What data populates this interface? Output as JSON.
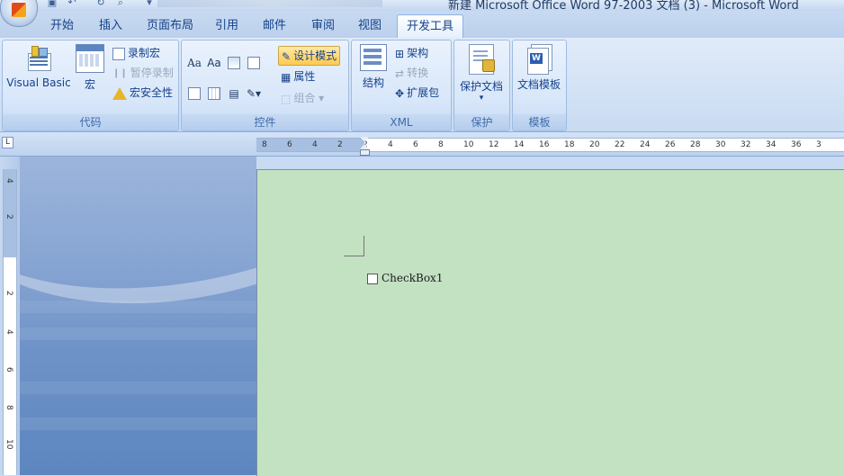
{
  "window": {
    "title": "新建 Microsoft Office Word 97-2003 文档 (3) - Microsoft Word"
  },
  "tabs": [
    {
      "label": "开始"
    },
    {
      "label": "插入"
    },
    {
      "label": "页面布局"
    },
    {
      "label": "引用"
    },
    {
      "label": "邮件"
    },
    {
      "label": "审阅"
    },
    {
      "label": "视图"
    },
    {
      "label": "开发工具",
      "active": true
    }
  ],
  "ribbon": {
    "code": {
      "label": "代码",
      "visual_basic": "Visual Basic",
      "macros": "宏",
      "record_macro": "录制宏",
      "pause_recording": "暂停录制",
      "macro_security": "宏安全性"
    },
    "controls": {
      "label": "控件",
      "rich_text": "Aa",
      "plain_text": "Aa",
      "design_mode": "设计模式",
      "properties": "属性",
      "group": "组合"
    },
    "xml": {
      "label": "XML",
      "structure": "结构",
      "schema": "架构",
      "transform": "转换",
      "expansion_packs": "扩展包"
    },
    "protect": {
      "label": "保护",
      "protect_document": "保护文档"
    },
    "templates": {
      "label": "模板",
      "document_template": "文档模板"
    }
  },
  "ruler": {
    "corner": "L",
    "h_ticks": [
      "8",
      "6",
      "4",
      "2",
      "2",
      "4",
      "6",
      "8",
      "10",
      "12",
      "14",
      "16",
      "18",
      "20",
      "22",
      "24",
      "26",
      "28",
      "30",
      "32",
      "34",
      "36",
      "3"
    ],
    "v_ticks": [
      "4",
      "2",
      "2",
      "4",
      "6",
      "8",
      "10"
    ]
  },
  "document": {
    "checkbox_label": "CheckBox1"
  },
  "colors": {
    "page_background": "#c3e2c2",
    "ribbon_text": "#15428b",
    "design_mode_active": "#ffc94d"
  }
}
